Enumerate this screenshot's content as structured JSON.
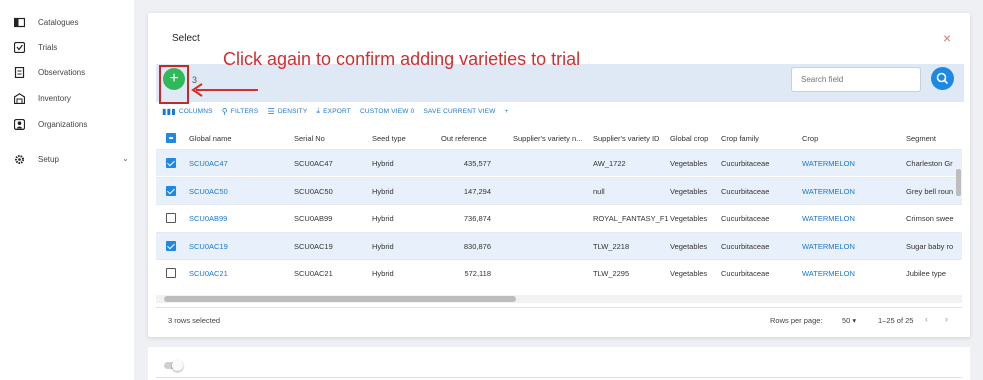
{
  "sidebar": {
    "items": [
      {
        "label": "Catalogues",
        "icon": "catalogue-icon"
      },
      {
        "label": "Trials",
        "icon": "trials-icon"
      },
      {
        "label": "Observations",
        "icon": "observations-icon"
      },
      {
        "label": "Inventory",
        "icon": "inventory-icon"
      },
      {
        "label": "Organizations",
        "icon": "organizations-icon"
      },
      {
        "label": "Setup",
        "icon": "setup-gear-icon",
        "chevron": "⌄"
      }
    ]
  },
  "dialog": {
    "title": "Select",
    "close": "×",
    "selected_count": "3",
    "search_placeholder": "Search field",
    "annotation": "Click again to confirm adding varieties to trial"
  },
  "grid_tools": {
    "columns": "COLUMNS",
    "filters": "FILTERS",
    "density": "DENSITY",
    "export": "EXPORT",
    "custom_view": "CUSTOM VIEW 0",
    "save_view": "SAVE CURRENT VIEW",
    "plus": "+"
  },
  "table": {
    "headers": [
      "Global name",
      "Serial No",
      "Seed type",
      "Out reference",
      "Supplier's variety n...",
      "Supplier's variety ID",
      "Global crop",
      "Crop family",
      "Crop",
      "Segment"
    ],
    "rows": [
      {
        "checked": true,
        "cells": [
          "SCU0AC47",
          "SCU0AC47",
          "Hybrid",
          "435,577",
          "",
          "AW_1722",
          "Vegetables",
          "Cucurbitaceae",
          "WATERMELON",
          "Charleston Gr"
        ]
      },
      {
        "checked": true,
        "cells": [
          "SCU0AC50",
          "SCU0AC50",
          "Hybrid",
          "147,294",
          "",
          "null",
          "Vegetables",
          "Cucurbitaceae",
          "WATERMELON",
          "Grey bell roun"
        ]
      },
      {
        "checked": false,
        "cells": [
          "SCU0AB99",
          "SCU0AB99",
          "Hybrid",
          "736,874",
          "",
          "ROYAL_FANTASY_F1",
          "Vegetables",
          "Cucurbitaceae",
          "WATERMELON",
          "Crimson swee"
        ]
      },
      {
        "checked": true,
        "cells": [
          "SCU0AC19",
          "SCU0AC19",
          "Hybrid",
          "830,876",
          "",
          "TLW_2218",
          "Vegetables",
          "Cucurbitaceae",
          "WATERMELON",
          "Sugar baby ro"
        ]
      },
      {
        "checked": false,
        "cells": [
          "SCU0AC21",
          "SCU0AC21",
          "Hybrid",
          "572,118",
          "",
          "TLW_2295",
          "Vegetables",
          "Cucurbitaceae",
          "WATERMELON",
          "Jubilee type"
        ]
      }
    ]
  },
  "footer": {
    "rows_selected": "3 rows selected",
    "rows_per_page_label": "Rows per page:",
    "rows_per_page_value": "50 ▾",
    "range": "1–25 of 25",
    "prev": "‹",
    "next": "›"
  },
  "colors": {
    "accent": "#1976d2",
    "add_button": "#2fb95b",
    "annotation": "#d32f2f",
    "close": "#e57373"
  }
}
